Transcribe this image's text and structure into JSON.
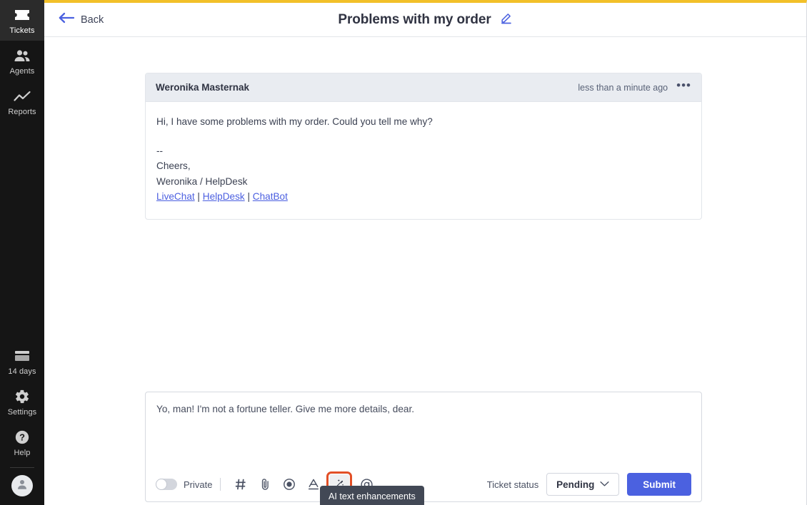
{
  "theme": {
    "accent_top_border": "#F2C029",
    "primary_blue": "#4B61E0",
    "link_blue": "#4B5FE0",
    "highlight_orange": "#E24F26",
    "sidebar_bg": "#151515",
    "message_header_bg": "#E9ECF1"
  },
  "sidebar": {
    "top_items": [
      {
        "id": "tickets",
        "label": "Tickets",
        "icon": "ticket-icon",
        "active": true
      },
      {
        "id": "agents",
        "label": "Agents",
        "icon": "agents-icon",
        "active": false
      },
      {
        "id": "reports",
        "label": "Reports",
        "icon": "reports-chart-icon",
        "active": false
      }
    ],
    "bottom_items": [
      {
        "id": "trial",
        "label": "14 days",
        "icon": "card-icon",
        "active": false
      },
      {
        "id": "settings",
        "label": "Settings",
        "icon": "gear-icon",
        "active": false
      },
      {
        "id": "help",
        "label": "Help",
        "icon": "question-circle-icon",
        "active": false
      }
    ],
    "avatar": {
      "icon": "user-avatar-icon"
    }
  },
  "topbar": {
    "back_label": "Back",
    "back_icon": "arrow-left-icon",
    "title": "Problems with my order",
    "edit_icon": "pencil-edit-icon"
  },
  "message": {
    "author": "Weronika Masternak",
    "timestamp": "less than a minute ago",
    "more_icon": "ellipsis-icon",
    "body_line_1": "Hi, I have some problems with my order. Could you tell me why?",
    "signature_dashes": "--",
    "signature_line_1": "Cheers,",
    "signature_line_2": "Weronika / HelpDesk",
    "links": [
      {
        "label": "LiveChat"
      },
      {
        "label": "HelpDesk"
      },
      {
        "label": "ChatBot"
      }
    ],
    "link_separator": "|"
  },
  "composer": {
    "draft_text": "Yo, man! I'm not a fortune teller. Give me more details, dear.",
    "private_toggle": {
      "label": "Private",
      "state": "off"
    },
    "tools": [
      {
        "id": "canned-response",
        "name": "hash-icon",
        "glyph": "#"
      },
      {
        "id": "attachment",
        "name": "paperclip-icon",
        "glyph": "✉"
      },
      {
        "id": "record",
        "name": "record-circle-icon",
        "glyph": "◉"
      },
      {
        "id": "text-format",
        "name": "text-format-icon",
        "glyph": "A"
      },
      {
        "id": "ai-enhancements",
        "name": "magic-wand-icon",
        "glyph": "✦"
      },
      {
        "id": "mention",
        "name": "at-mention-icon",
        "glyph": "@"
      }
    ],
    "ticket_status_label": "Ticket status",
    "ticket_status_value": "Pending",
    "ticket_status_options": [
      "Pending"
    ],
    "chevron_icon": "chevron-down-icon",
    "submit_label": "Submit"
  },
  "tooltip": {
    "text": "AI text enhancements",
    "target": "ai-enhancements"
  }
}
